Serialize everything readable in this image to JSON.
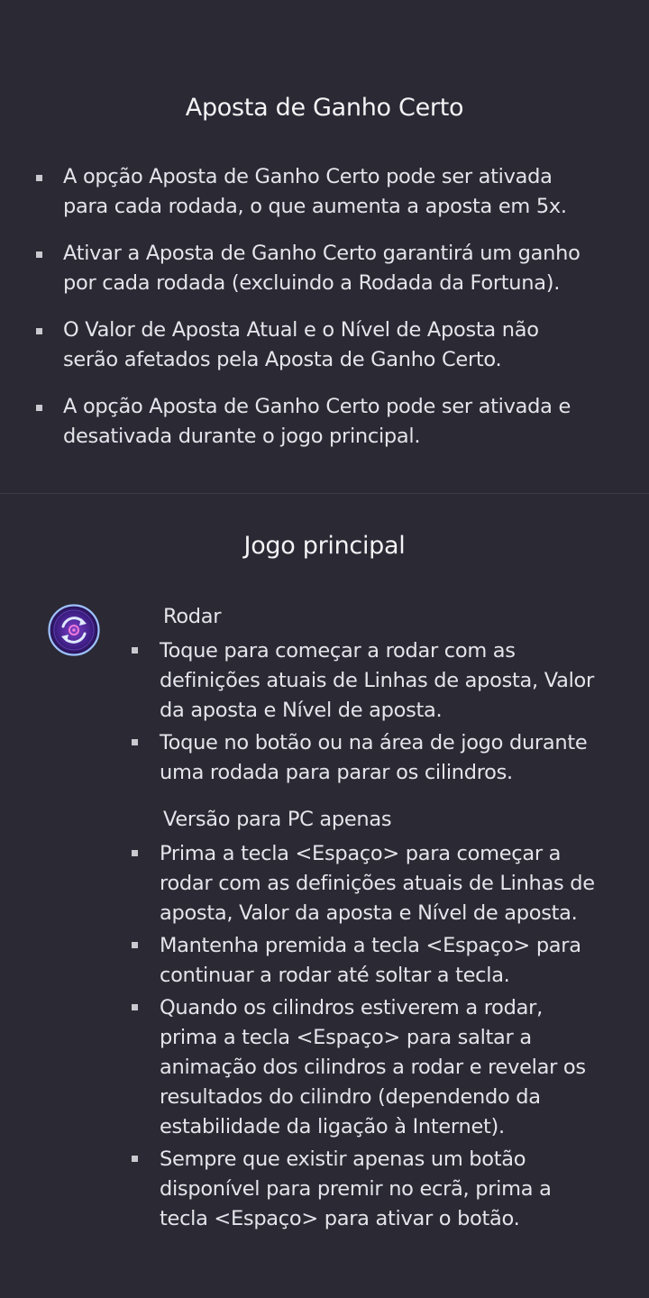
{
  "sure_win": {
    "title": "Aposta de Ganho Certo",
    "items": [
      {
        "line1": "A opção Aposta de Ganho Certo pode ser ativada",
        "line2": "para cada rodada, o que aumenta a aposta em 5x."
      },
      {
        "line1": "Ativar a Aposta de Ganho Certo garantirá um ganho",
        "line2": "por cada rodada (excluindo a Rodada da Fortuna)."
      },
      {
        "line1": "O Valor de Aposta Atual e o Nível de Aposta não",
        "line2": "serão afetados pela Aposta de Ganho Certo."
      },
      {
        "line1": "A opção Aposta de Ganho Certo pode ser ativada e",
        "line2": "desativada durante o jogo principal."
      }
    ]
  },
  "main_game": {
    "title": "Jogo principal",
    "spin_icon": "spin-button-icon",
    "spin": {
      "label": "Rodar",
      "items": [
        {
          "lines": [
            "Toque para começar a rodar com as",
            "definições atuais de Linhas de aposta, Valor",
            "da aposta e Nível de aposta."
          ]
        },
        {
          "lines": [
            "Toque no botão ou na área de jogo durante",
            "uma rodada para parar os cilindros."
          ]
        }
      ]
    },
    "pc": {
      "label": "Versão para PC apenas",
      "items": [
        {
          "lines": [
            "Prima a tecla <Espaço> para começar a",
            "rodar com as definições atuais de Linhas de",
            "aposta, Valor da aposta e Nível de aposta."
          ]
        },
        {
          "lines": [
            "Mantenha premida a tecla <Espaço> para",
            "continuar a rodar até soltar a tecla."
          ]
        },
        {
          "lines": [
            "Quando os cilindros estiverem a rodar,",
            "prima a tecla <Espaço> para saltar a",
            "animação dos cilindros a rodar e revelar os",
            "resultados do cilindro (dependendo da",
            "estabilidade da ligação à Internet)."
          ]
        },
        {
          "lines": [
            "Sempre que existir apenas um botão",
            "disponível para premir no ecrã, prima a",
            "tecla <Espaço> para ativar o botão."
          ]
        }
      ]
    }
  }
}
